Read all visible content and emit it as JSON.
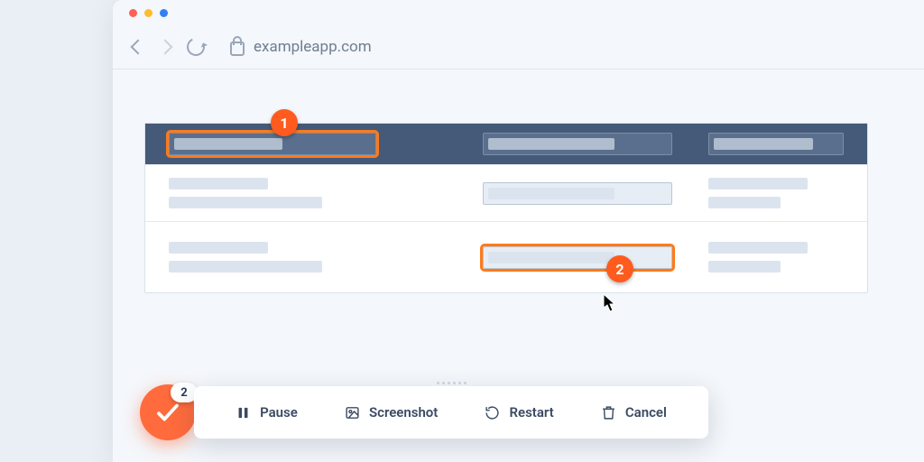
{
  "browser": {
    "url": "exampleapp.com"
  },
  "annotations": {
    "step1": "1",
    "step2": "2"
  },
  "toolbar": {
    "pause": "Pause",
    "screenshot": "Screenshot",
    "restart": "Restart",
    "cancel": "Cancel"
  },
  "fab": {
    "count": "2"
  }
}
